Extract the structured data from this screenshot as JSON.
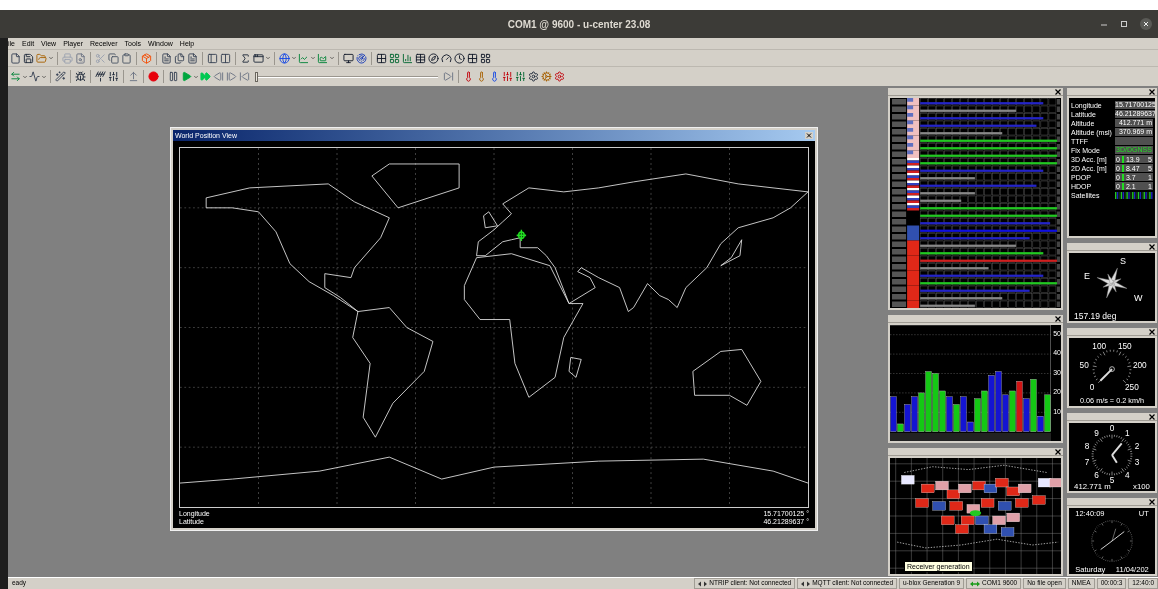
{
  "window": {
    "title": "COM1 @ 9600 - u-center 23.08"
  },
  "menu": [
    {
      "label": "ile"
    },
    {
      "label": "Edit"
    },
    {
      "label": "View"
    },
    {
      "label": "Player"
    },
    {
      "label": "Receiver"
    },
    {
      "label": "Tools"
    },
    {
      "label": "Window"
    },
    {
      "label": "Help"
    }
  ],
  "player_slider": {
    "level": 0
  },
  "world_view": {
    "title": "World Position View",
    "longitude_label": "Longitude",
    "latitude_label": "Latitude",
    "longitude": "15.71700125 °",
    "latitude": "46.21289637 °"
  },
  "data_panel": {
    "rows": [
      {
        "label": "Longitude",
        "kind": "value",
        "value": "15.71700125"
      },
      {
        "label": "Latitude",
        "kind": "value",
        "value": "46.21289637"
      },
      {
        "label": "Altitude",
        "kind": "value",
        "value": "412.771 m"
      },
      {
        "label": "Altitude (msl)",
        "kind": "value",
        "value": "370.969 m"
      },
      {
        "label": "TTFF",
        "kind": "blank"
      },
      {
        "label": "Fix Mode",
        "kind": "fix",
        "value": "3D/DGNSS"
      },
      {
        "label": "3D Acc. [m]",
        "kind": "bar",
        "min": "0",
        "value": "13.9",
        "max": "5"
      },
      {
        "label": "2D Acc. [m]",
        "kind": "bar",
        "min": "0",
        "value": "8.47",
        "max": "5"
      },
      {
        "label": "PDOP",
        "kind": "bar",
        "min": "0",
        "value": "3.7",
        "max": "1"
      },
      {
        "label": "HDOP",
        "kind": "bar",
        "min": "0",
        "value": "2.1",
        "max": "1"
      },
      {
        "label": "Satellites",
        "kind": "sats"
      }
    ]
  },
  "signal_chart": {
    "chart_data": {
      "type": "bar",
      "ylim": [
        0,
        55
      ],
      "yticks": [
        10,
        20,
        30,
        40,
        50
      ],
      "grid": true,
      "series": [
        {
          "color": "#1414d2",
          "values": [
            18,
            null,
            14,
            18,
            null,
            null,
            null,
            null,
            18,
            null,
            18,
            5,
            null,
            null,
            29,
            31,
            19,
            null,
            null,
            17,
            null,
            8,
            null
          ]
        },
        {
          "color": "#14c814",
          "values": [
            null,
            4,
            null,
            null,
            20,
            31,
            30,
            21,
            null,
            14,
            null,
            null,
            17,
            21,
            null,
            null,
            null,
            21,
            null,
            null,
            27,
            null,
            19
          ]
        },
        {
          "color": "#d21414",
          "values": [
            null,
            null,
            null,
            null,
            null,
            null,
            null,
            null,
            null,
            null,
            null,
            null,
            null,
            null,
            null,
            null,
            null,
            null,
            26,
            null,
            null,
            null,
            null
          ]
        }
      ]
    }
  },
  "compass": {
    "labels": [
      "S",
      "E",
      "W"
    ],
    "reading": "157.19 deg"
  },
  "speed_gauge": {
    "ticks": [
      "0",
      "50",
      "100",
      "150",
      "200",
      "250"
    ],
    "reading": "0.06 m/s = 0.2 km/h"
  },
  "altitude_gauge": {
    "ticks": [
      "0",
      "1",
      "2",
      "3",
      "4",
      "5",
      "6",
      "7",
      "8",
      "9"
    ],
    "reading": "412.771 m",
    "unit": "x100"
  },
  "clock": {
    "time": "12:40:09",
    "zone": "UT",
    "day": "Saturday",
    "date": "11/04/202"
  },
  "tooltip": "Receiver generation",
  "status_bar": [
    {
      "text": "eady",
      "kind": "plain"
    },
    {
      "text": "NTRIP client: Not connected",
      "kind": "link"
    },
    {
      "text": "MQTT client: Not connected",
      "kind": "link"
    },
    {
      "text": "u-blox Generation 9",
      "kind": "plain"
    },
    {
      "text": "COM1 9600",
      "kind": "port"
    },
    {
      "text": "No file open",
      "kind": "plain"
    },
    {
      "text": "NMEA",
      "kind": "plain"
    },
    {
      "text": "00:00:3",
      "kind": "plain"
    },
    {
      "text": "12:40:0",
      "kind": "plain"
    }
  ]
}
